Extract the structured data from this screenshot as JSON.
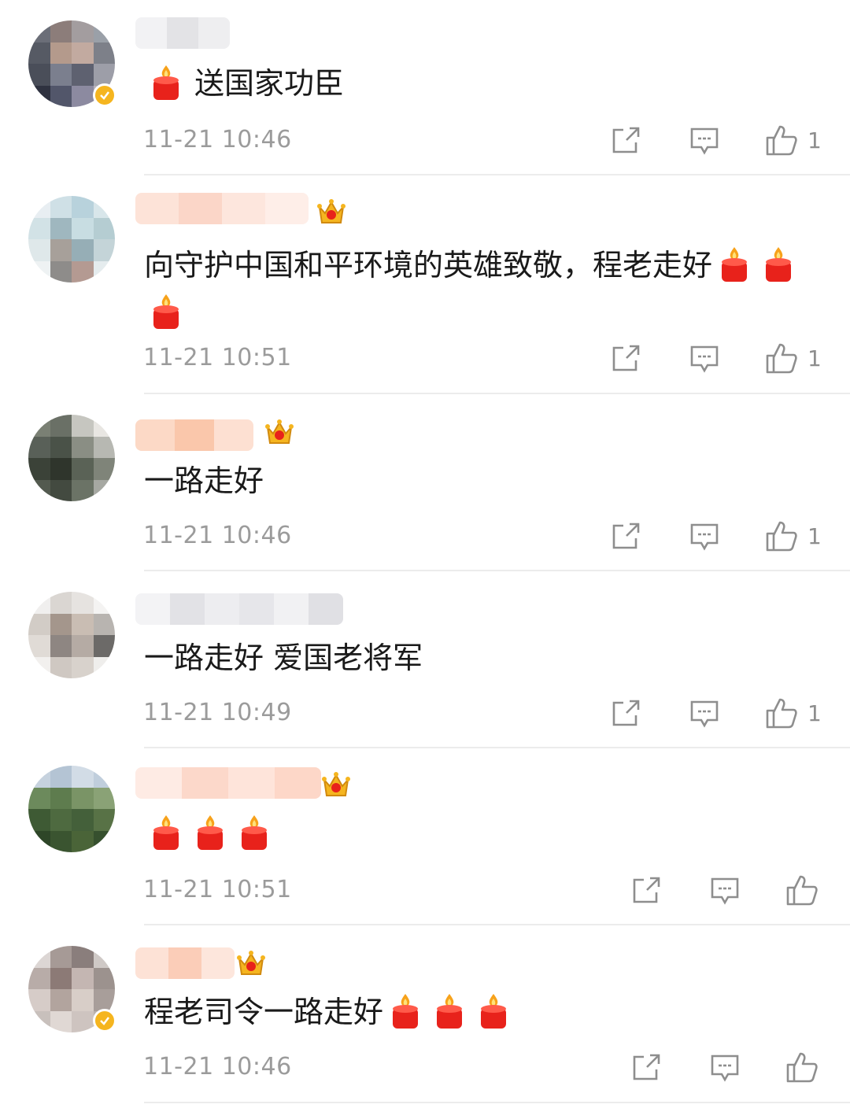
{
  "comments": [
    {
      "content": "送国家功臣",
      "candle_positions": "before",
      "candles": 1,
      "time": "11-21 10:46",
      "likes": "1",
      "has_crown": false,
      "has_badge": true
    },
    {
      "content": "向守护中国和平环境的英雄致敬，程老走好",
      "candle_positions": "after",
      "candles": 3,
      "time": "11-21 10:51",
      "likes": "1",
      "has_crown": true,
      "has_badge": false
    },
    {
      "content": "一路走好",
      "candles": 0,
      "time": "11-21 10:46",
      "likes": "1",
      "has_crown": true,
      "has_badge": false
    },
    {
      "content": "一路走好 爱国老将军",
      "candles": 0,
      "time": "11-21 10:49",
      "likes": "1",
      "has_crown": false,
      "has_badge": false
    },
    {
      "content": "",
      "candle_positions": "only",
      "candles": 3,
      "time": "11-21 10:51",
      "likes": "",
      "has_crown": true,
      "has_badge": false
    },
    {
      "content": "程老司令一路走好",
      "candle_positions": "after",
      "candles": 3,
      "time": "11-21 10:46",
      "likes": "",
      "has_crown": true,
      "has_badge": true
    }
  ],
  "icons": {
    "share": "share-icon",
    "comment": "comment-icon",
    "like": "thumbs-up-icon",
    "candle": "candle-emoji-icon",
    "crown": "vip-crown-icon",
    "badge": "verified-badge-icon"
  },
  "colors": {
    "text": "#1a1a1a",
    "meta": "#9b9b9b",
    "divider": "#ececec",
    "candle_red": "#e8221b",
    "flame": "#f7a21b",
    "crown_gold": "#f5b51f"
  }
}
